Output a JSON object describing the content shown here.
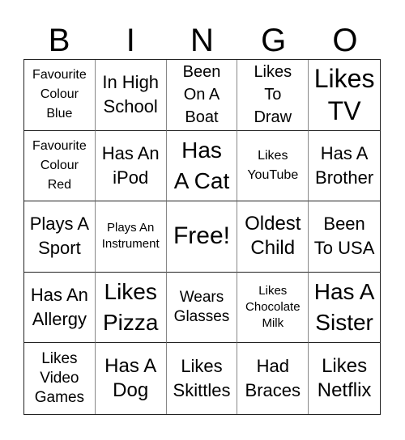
{
  "header": {
    "letters": [
      "B",
      "I",
      "N",
      "G",
      "O"
    ]
  },
  "board": {
    "cells": [
      "Favourite\nColour\nBlue",
      "In High\nSchool",
      "Been\nOn A\nBoat",
      "Likes\nTo\nDraw",
      "Likes\nTV",
      "Favourite\nColour\nRed",
      "Has An\niPod",
      "Has\nA Cat",
      "Likes\nYouTube",
      "Has A\nBrother",
      "Plays A\nSport",
      "Plays An\nInstrument",
      "Free!",
      "Oldest\nChild",
      "Been\nTo USA",
      "Has An\nAllergy",
      "Likes\nPizza",
      "Wears\nGlasses",
      "Likes\nChocolate\nMilk",
      "Has A\nSister",
      "Likes\nVideo\nGames",
      "Has A\nDog",
      "Likes\nSkittles",
      "Had\nBraces",
      "Likes\nNetflix"
    ]
  }
}
